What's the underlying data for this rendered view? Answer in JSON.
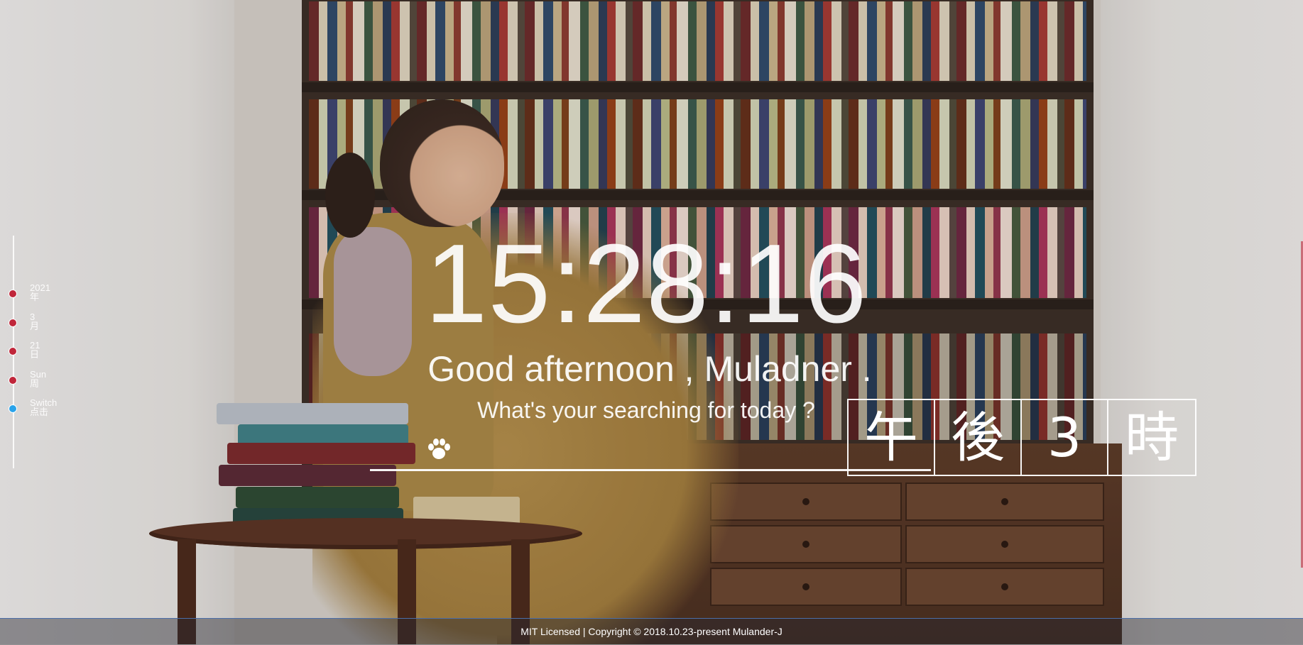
{
  "timeline": {
    "items": [
      {
        "top": "2021",
        "bottom": "年",
        "dot": "red"
      },
      {
        "top": "3",
        "bottom": "月",
        "dot": "red"
      },
      {
        "top": "21",
        "bottom": "日",
        "dot": "red"
      },
      {
        "top": "Sun",
        "bottom": "周",
        "dot": "red"
      },
      {
        "top": "Switch",
        "bottom": "点击",
        "dot": "blue"
      }
    ]
  },
  "clock": {
    "time": "15:28:16"
  },
  "greeting": {
    "text": "Good afternoon , Muladner ."
  },
  "search": {
    "prompt": "What's your searching for today ?",
    "paw_icon": "paw-icon"
  },
  "japanese_hour": {
    "chars": [
      "午",
      "後",
      "3",
      "時"
    ]
  },
  "footer": {
    "text": "MIT Licensed | Copyright © 2018.10.23-present Mulander-J"
  },
  "colors": {
    "dot_red": "#c0263a",
    "dot_blue": "#2aa3ea",
    "footer_line": "#4b6ea8"
  }
}
